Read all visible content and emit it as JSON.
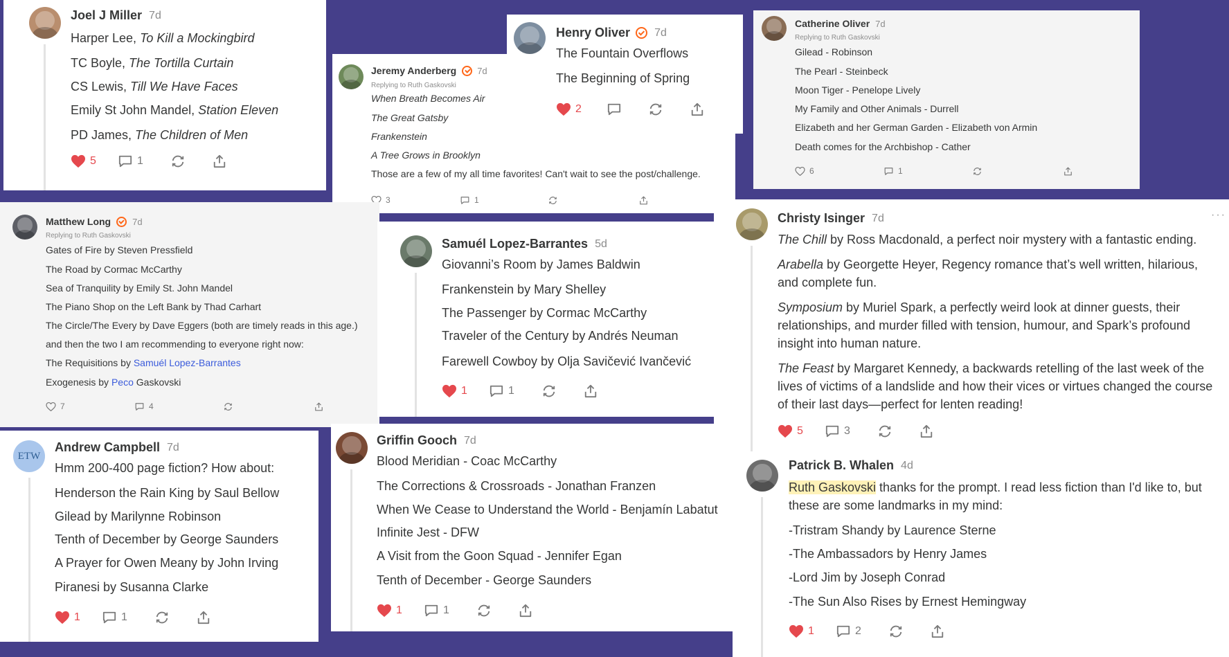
{
  "colors": {
    "background": "#453f8a",
    "like_red": "#e5484d",
    "verified_orange": "#ff6719",
    "link_blue": "#3b5bdb",
    "highlight": "#fff2b8"
  },
  "comments": {
    "joel": {
      "name": "Joel J Miller",
      "time": "7d",
      "lines": [
        {
          "pre": "Harper Lee, ",
          "em": "To Kill a Mockingbird"
        },
        {
          "pre": "TC Boyle, ",
          "em": "The Tortilla Curtain"
        },
        {
          "pre": "CS Lewis, ",
          "em": "Till We Have Faces"
        },
        {
          "pre": "Emily St John Mandel, ",
          "em": "Station Eleven"
        },
        {
          "pre": "PD James, ",
          "em": "The Children of Men"
        }
      ],
      "likes": "5",
      "replies": "1"
    },
    "jeremy": {
      "name": "Jeremy Anderberg",
      "time": "7d",
      "replying": "Replying to Ruth Gaskovski",
      "lines": [
        "When Breath Becomes Air",
        "The Great Gatsby",
        "Frankenstein",
        "A Tree Grows in Brooklyn"
      ],
      "note": "Those are a few of my all time favorites! Can't wait to see the post/challenge.",
      "likes": "3",
      "replies": "1"
    },
    "henry": {
      "name": "Henry Oliver",
      "time": "7d",
      "lines": [
        "The Fountain Overflows",
        "The Beginning of Spring"
      ],
      "likes": "2"
    },
    "catherine": {
      "name": "Catherine Oliver",
      "time": "7d",
      "replying": "Replying to Ruth Gaskovski",
      "lines": [
        "Gilead - Robinson",
        "The Pearl - Steinbeck",
        "Moon Tiger - Penelope Lively",
        "My Family and Other Animals - Durrell",
        "Elizabeth and her German Garden - Elizabeth von Armin",
        "Death comes for the Archbishop - Cather"
      ],
      "likes": "6",
      "replies": "1"
    },
    "matthew": {
      "name": "Matthew Long",
      "time": "7d",
      "replying": "Replying to Ruth Gaskovski",
      "lines": [
        "Gates of Fire by Steven Pressfield",
        "The Road by Cormac McCarthy",
        "Sea of Tranquility by Emily St. John Mandel",
        "The Piano Shop on the Left Bank by Thad Carhart",
        "The Circle/The Every by Dave Eggers (both are timely reads in this age.)",
        "and then the two I am recommending to everyone right now:"
      ],
      "req_pre": "The Requisitions by ",
      "req_link": "Samuél Lopez-Barrantes",
      "exo_pre": "Exogenesis by ",
      "exo_link": "Peco",
      "exo_post": " Gaskovski",
      "likes": "7",
      "replies": "4"
    },
    "samuel": {
      "name": "Samuél Lopez-Barrantes",
      "time": "5d",
      "lines": [
        "Giovanni’s Room by James Baldwin",
        "Frankenstein by Mary Shelley",
        "The Passenger by Cormac McCarthy",
        "Traveler of the Century by Andrés Neuman",
        "Farewell Cowboy by Olja Savičević Ivančević"
      ],
      "likes": "1",
      "replies": "1"
    },
    "christy": {
      "name": "Christy Isinger",
      "time": "7d",
      "more": "···",
      "paras": [
        {
          "em": "The Chill",
          "rest": " by Ross Macdonald, a perfect noir mystery with a fantastic ending."
        },
        {
          "em": "Arabella",
          "rest": " by Georgette Heyer, Regency romance that’s well written, hilarious, and complete fun."
        },
        {
          "em": "Symposium",
          "rest": " by Muriel Spark, a perfectly weird look at dinner guests, their relationships, and murder filled with tension, humour, and Spark’s profound insight into human nature."
        },
        {
          "em": "The Feast",
          "rest": " by Margaret Kennedy, a backwards retelling of the last week of the lives of victims of a landslide and how their vices or virtues changed the course of their last days—perfect for lenten reading!"
        }
      ],
      "likes": "5",
      "replies": "3"
    },
    "andrew": {
      "name": "Andrew Campbell",
      "time": "7d",
      "initials": "ETW",
      "lines": [
        "Hmm 200-400 page fiction? How about:",
        "Henderson the Rain King by Saul Bellow",
        "Gilead by Marilynne Robinson",
        "Tenth of December by George Saunders",
        "A Prayer for Owen Meany by John Irving",
        "Piranesi by Susanna Clarke"
      ],
      "likes": "1",
      "replies": "1"
    },
    "griffin": {
      "name": "Griffin Gooch",
      "time": "7d",
      "lines": [
        "Blood Meridian - Coac McCarthy",
        "The Corrections & Crossroads - Jonathan Franzen",
        "When We Cease to Understand the World - Benjamín Labatut",
        "Infinite Jest - DFW",
        "A Visit from the Goon Squad - Jennifer Egan",
        "Tenth of December - George Saunders"
      ],
      "likes": "1",
      "replies": "1"
    },
    "patrick": {
      "name": "Patrick B. Whalen",
      "time": "4d",
      "mention": "Ruth Gaskovski",
      "intro": " thanks for the prompt. I read less fiction than I'd like to, but these are some landmarks in my mind:",
      "lines": [
        "-Tristram Shandy by Laurence Sterne",
        "-The Ambassadors by Henry James",
        "-Lord Jim by Joseph Conrad",
        "-The Sun Also Rises by Ernest Hemingway"
      ],
      "likes": "1",
      "replies": "2"
    }
  }
}
